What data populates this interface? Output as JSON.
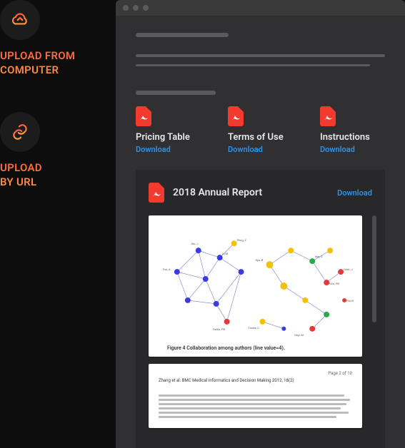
{
  "sidebar": {
    "upload_computer": {
      "label": "UPLOAD FROM\nCOMPUTER"
    },
    "upload_url": {
      "label": "UPLOAD\nBY URL"
    }
  },
  "cards": [
    {
      "title": "Pricing Table",
      "dl": "Download"
    },
    {
      "title": "Terms of Use",
      "dl": "Download"
    },
    {
      "title": "Instructions",
      "dl": "Download"
    }
  ],
  "feature": {
    "title": "2018 Annual Report",
    "dl": "Download",
    "graph_caption": "Figure 4 Collaboration among authors (line value=4).",
    "page2_header": "Zhang et al. BMC Medical Informatics and Decision Making 2012, 18(2)",
    "page2_num": "Page 2 of 10"
  }
}
